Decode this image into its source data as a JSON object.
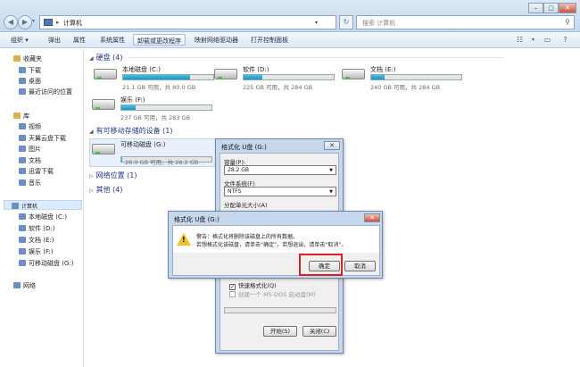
{
  "window": {
    "title": "计算机",
    "controls": [
      "–",
      "▢",
      "✕"
    ]
  },
  "address": {
    "crumb": "计算机",
    "separator": "▸"
  },
  "search": {
    "placeholder": "搜索 计算机"
  },
  "toolbar": {
    "organize": "组织 ▾",
    "eject": "弹出",
    "properties": "属性",
    "system_properties": "系统属性",
    "uninstall": "卸载或更改程序",
    "map_drive": "映射网络驱动器",
    "control_panel": "打开控制面板"
  },
  "sidebar": {
    "favorites": "收藏夹",
    "downloads": "下载",
    "desktop": "桌面",
    "recent": "最近访问的位置",
    "library": "库",
    "videos": "视频",
    "tianyi": "天翼云盘下载",
    "pictures": "图片",
    "documents": "文档",
    "xunlei": "迅雷下载",
    "music": "音乐",
    "computer": "计算机",
    "c": "本地磁盘 (C:)",
    "d": "软件 (D:)",
    "e": "文档 (E:)",
    "f": "娱乐 (F:)",
    "g": "可移动磁盘 (G:)",
    "network": "网络"
  },
  "groups": {
    "hdd": "硬盘 (4)",
    "removable": "有可移动存储的设备 (1)",
    "netloc": "网络位置 (1)",
    "other": "其他 (4)"
  },
  "drives": [
    {
      "name": "本地磁盘 (C:)",
      "size": "21.1 GB 可用，共 80.0 GB",
      "used": 0.74
    },
    {
      "name": "软件 (D:)",
      "size": "225 GB 可用，共 284 GB",
      "used": 0.21
    },
    {
      "name": "文档 (E:)",
      "size": "240 GB 可用，共 284 GB",
      "used": 0.15
    },
    {
      "name": "娱乐 (F:)",
      "size": "237 GB 可用，共 283 GB",
      "used": 0.16
    },
    {
      "name": "可移动磁盘 (G:)",
      "size": "28.0 GB 可用，共 28.2 GB",
      "used": 0.01
    }
  ],
  "format_dialog": {
    "title": "格式化 U盘 (G:)",
    "capacity_label": "容量(P):",
    "capacity": "28.2 GB",
    "fs_label": "文件系统(F)",
    "fs": "NTFS",
    "alloc_label": "分配单元大小(A)",
    "quick": "快速格式化(Q)",
    "msdos": "创建一个 MS-DOS 启动盘(M)",
    "start": "开始(S)",
    "close": "关闭(C)"
  },
  "confirm_dialog": {
    "title": "格式化 U盘 (G:)",
    "line1": "警告：格式化将删除该磁盘上的所有数据。",
    "line2": "若想格式化该磁盘，请单击“确定”。若想退出，请单击“取消”。",
    "ok": "确定",
    "cancel": "取消"
  }
}
